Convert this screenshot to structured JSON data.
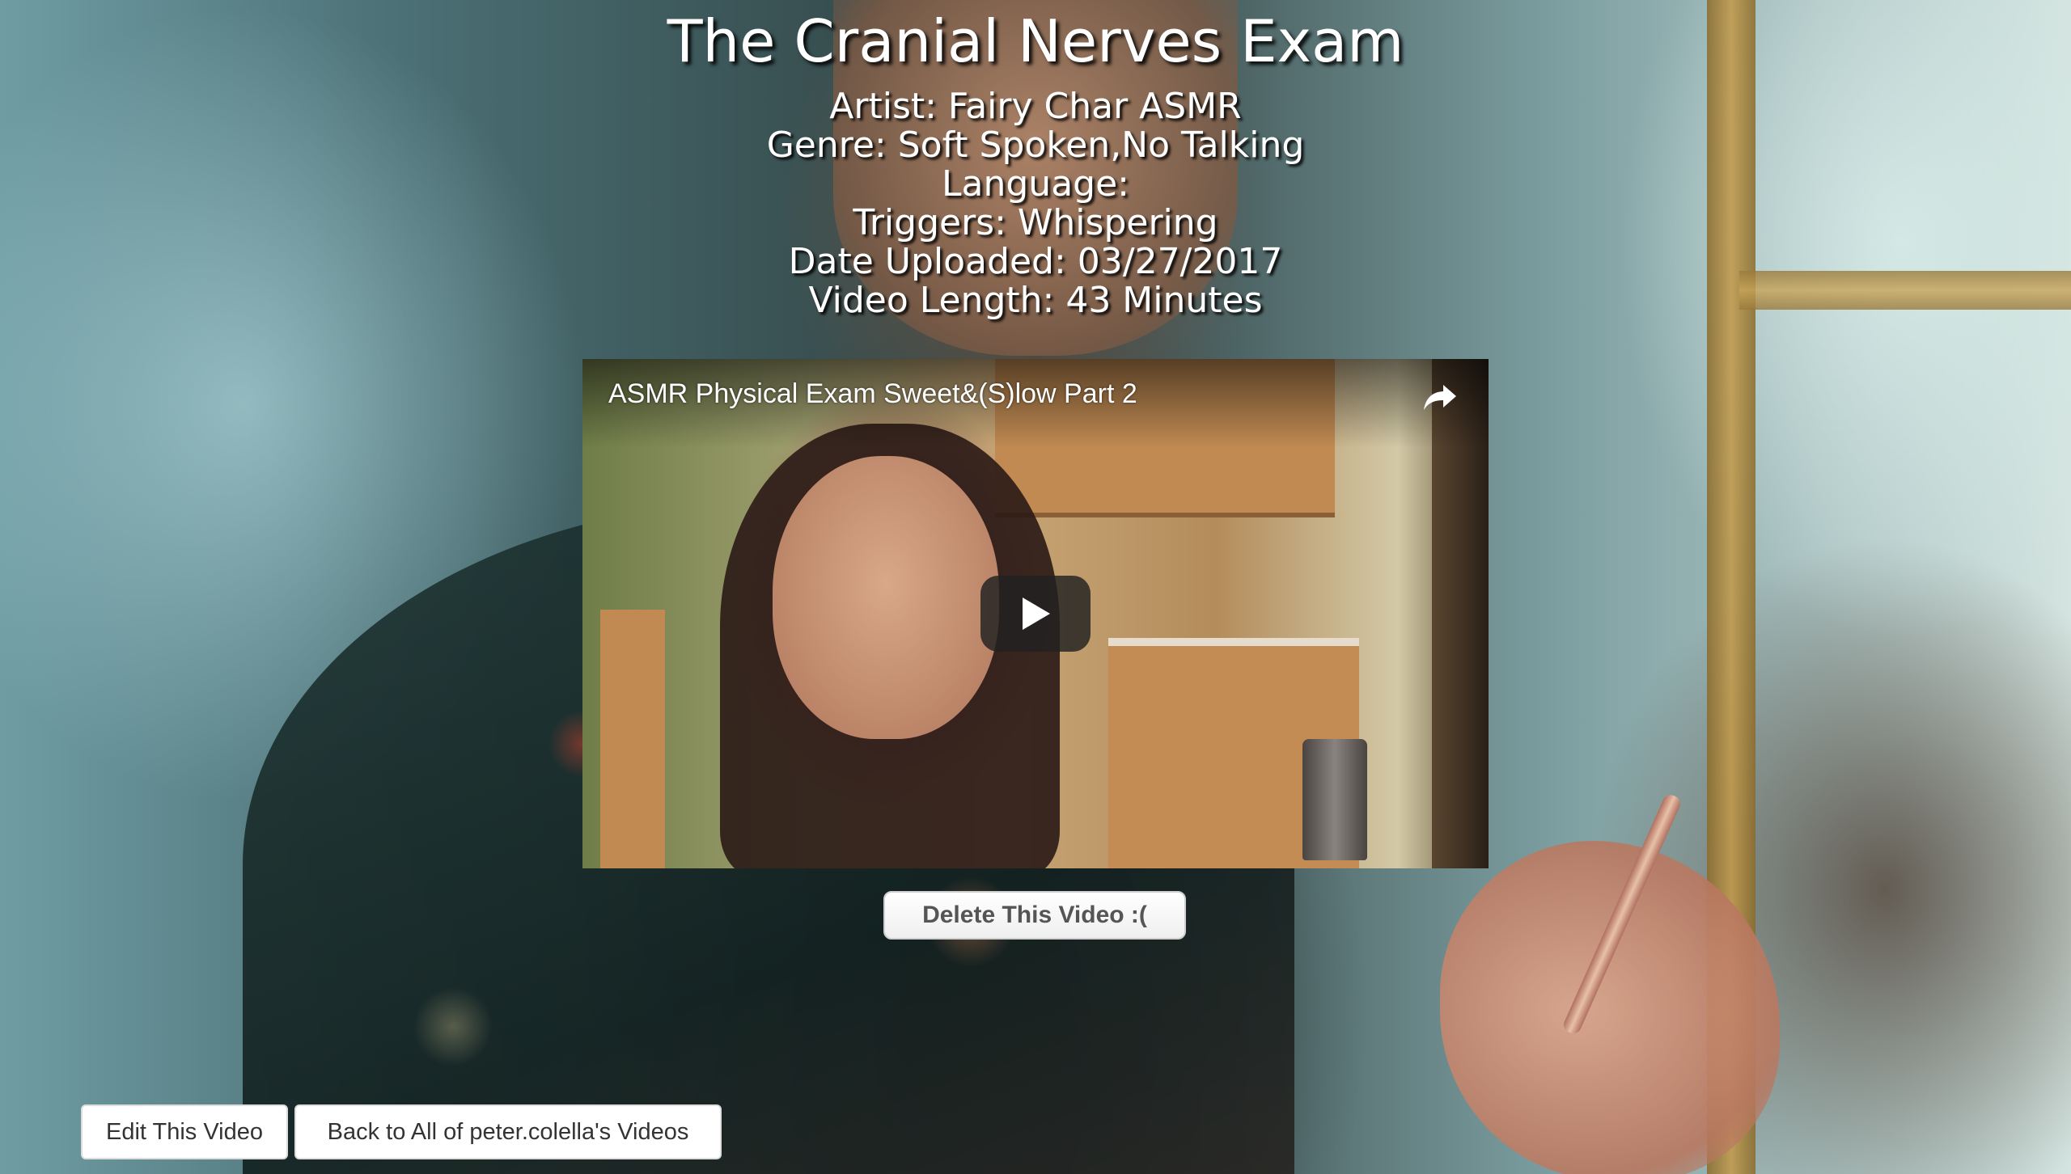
{
  "page": {
    "title": "The Cranial Nerves Exam"
  },
  "details": {
    "artist": "Artist: Fairy Char ASMR",
    "genre": "Genre: Soft Spoken,No Talking",
    "language": "Language:",
    "triggers": "Triggers: Whispering",
    "date_uploaded": "Date Uploaded: 03/27/2017",
    "video_length": "Video Length: 43 Minutes"
  },
  "video": {
    "title": "ASMR Physical Exam Sweet&(S)low Part 2",
    "share_icon": "share-arrow-icon",
    "play_icon": "play-icon"
  },
  "actions": {
    "delete_label": "Delete This Video :(",
    "edit_label": "Edit This Video",
    "back_label": "Back to All of peter.colella's Videos"
  },
  "colors": {
    "heading_text": "#ffffff",
    "button_bg": "#ffffff",
    "delete_text": "#555555",
    "play_button_bg": "#212121"
  }
}
